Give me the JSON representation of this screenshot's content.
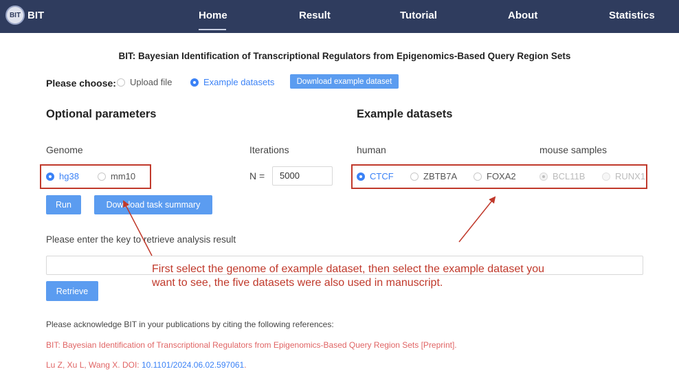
{
  "nav": {
    "logo_text": "BIT",
    "brand": "BIT",
    "items": [
      "Home",
      "Result",
      "Tutorial",
      "About",
      "Statistics"
    ],
    "active": "Home"
  },
  "title": "BIT: Bayesian Identification of Transcriptional Regulators from Epigenomics-Based Query Region Sets",
  "choose": {
    "label": "Please choose:",
    "options": [
      "Upload file",
      "Example datasets"
    ],
    "selected": "Example datasets",
    "download_button": "Download example dataset"
  },
  "optional": {
    "title": "Optional parameters",
    "genome_label": "Genome",
    "genome_options": [
      "hg38",
      "mm10"
    ],
    "genome_selected": "hg38",
    "iterations_label": "Iterations",
    "n_label": "N =",
    "n_value": "5000",
    "run_button": "Run",
    "download_summary_button": "Download task summary"
  },
  "examples": {
    "title": "Example datasets",
    "human_label": "human",
    "mouse_label": "mouse samples",
    "human_options": [
      "CTCF",
      "ZBTB7A",
      "FOXA2"
    ],
    "mouse_options": [
      "BCL11B",
      "RUNX1"
    ],
    "selected": "CTCF"
  },
  "retrieve": {
    "label": "Please enter the key to retrieve analysis result",
    "input_value": "",
    "button": "Retrieve"
  },
  "annotation": "First select the genome of example dataset, then select the example dataset you want to see, the five datasets were also used in manuscript.",
  "acknowledge": {
    "text": "Please acknowledge BIT in your publications by citing the following references:",
    "ref1": "BIT: Bayesian Identification of Transcriptional Regulators from Epigenomics-Based Query Region Sets [Preprint].",
    "ref2_prefix": "Lu Z, Xu L, Wang X. DOI: ",
    "ref2_doi": "10.1101/2024.06.02.597061",
    "ref2_suffix": "."
  },
  "colors": {
    "nav_bg": "#2f3c5e",
    "accent": "#3b82f6",
    "annotation_red": "#c0392b",
    "reference_red": "#e06464"
  }
}
